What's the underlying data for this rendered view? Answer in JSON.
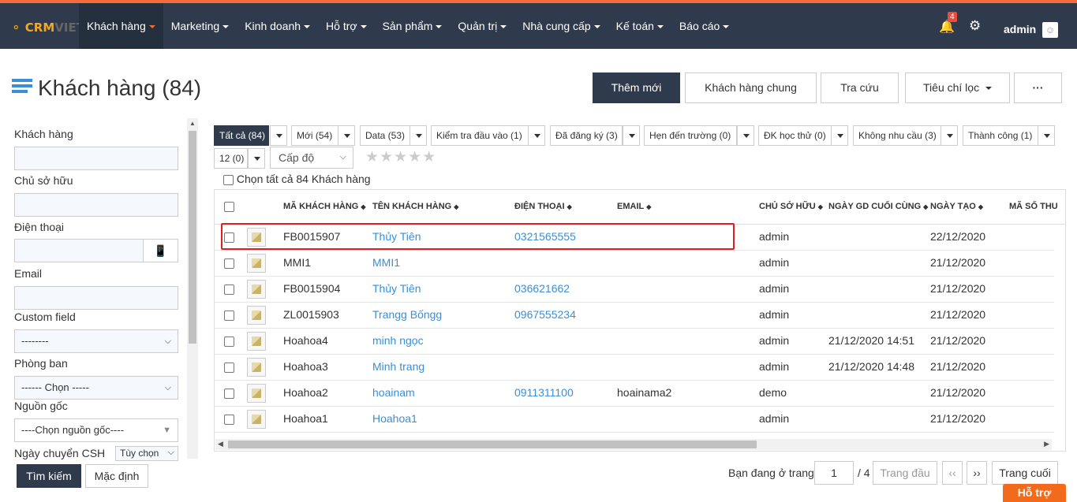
{
  "app": {
    "logo_brand": "CRM",
    "logo_suffix": "VIET"
  },
  "nav": {
    "items": [
      {
        "label": "Khách hàng"
      },
      {
        "label": "Marketing"
      },
      {
        "label": "Kinh doanh"
      },
      {
        "label": "Hỗ trợ"
      },
      {
        "label": "Sản phẩm"
      },
      {
        "label": "Quản trị"
      },
      {
        "label": "Nhà cung cấp"
      },
      {
        "label": "Kế toán"
      },
      {
        "label": "Báo cáo"
      }
    ]
  },
  "header": {
    "notification_count": "4",
    "user_name": "admin",
    "bell_icon": "bell-icon",
    "gear_icon": "gear-icon"
  },
  "page": {
    "title": "Khách hàng (84)"
  },
  "actions": {
    "add_new": "Thêm mới",
    "shared": "Khách hàng chung",
    "lookup": "Tra cứu",
    "criteria": "Tiêu chí lọc",
    "more": "···"
  },
  "sidebar": {
    "customer_label": "Khách hàng",
    "owner_label": "Chủ sở hữu",
    "phone_label": "Điện thoại",
    "email_label": "Email",
    "custom_field_label": "Custom field",
    "custom_field_value": "--------",
    "department_label": "Phòng ban",
    "department_value": "------ Chọn -----",
    "source_label": "Nguồn gốc",
    "source_value": "----Chọn nguồn gốc----",
    "transfer_date_label": "Ngày chuyển CSH",
    "transfer_date_value": "Tùy chọn",
    "search_button": "Tìm kiếm",
    "default_button": "Mặc định"
  },
  "filters": {
    "tabs": [
      {
        "label": "Tất cả (84)"
      },
      {
        "label": "Mới (54)"
      },
      {
        "label": "Data (53)"
      },
      {
        "label": "Kiểm tra đầu vào (1)"
      },
      {
        "label": "Đã đăng ký (3)"
      },
      {
        "label": "Hẹn đến trường (0)"
      },
      {
        "label": "ĐK học thử (0)"
      },
      {
        "label": "Không nhu cầu (3)"
      },
      {
        "label": "Thành công (1)"
      },
      {
        "label": "12 (0)"
      }
    ],
    "level_placeholder": "Cấp độ",
    "stars": "★★★★★",
    "select_all": "Chọn tất cả 84 Khách hàng"
  },
  "table": {
    "columns": [
      "MÃ KHÁCH HÀNG",
      "TÊN KHÁCH HÀNG",
      "ĐIỆN THOẠI",
      "EMAIL",
      "CHỦ SỞ HỮU",
      "NGÀY GD CUỐI CÙNG",
      "NGÀY TẠO",
      "MÃ SỐ THU"
    ],
    "rows": [
      {
        "code": "FB0015907",
        "name": "Thủy Tiên",
        "phone": "0321565555",
        "email": "",
        "owner": "admin",
        "last_trans": "",
        "created": "22/12/2020"
      },
      {
        "code": "MMI1",
        "name": "MMI1",
        "phone": "",
        "email": "",
        "owner": "admin",
        "last_trans": "",
        "created": "21/12/2020"
      },
      {
        "code": "FB0015904",
        "name": "Thủy Tiên",
        "phone": "036621662",
        "email": "",
        "owner": "admin",
        "last_trans": "",
        "created": "21/12/2020"
      },
      {
        "code": "ZL0015903",
        "name": "Trangg Bốngg",
        "phone": "0967555234",
        "email": "",
        "owner": "admin",
        "last_trans": "",
        "created": "21/12/2020"
      },
      {
        "code": "Hoahoa4",
        "name": "minh ngọc",
        "phone": "",
        "email": "",
        "owner": "admin",
        "last_trans": "21/12/2020 14:51",
        "created": "21/12/2020"
      },
      {
        "code": "Hoahoa3",
        "name": "Minh trang",
        "phone": "",
        "email": "",
        "owner": "admin",
        "last_trans": "21/12/2020 14:48",
        "created": "21/12/2020"
      },
      {
        "code": "Hoahoa2",
        "name": "hoainam",
        "phone": "0911311100",
        "email": "hoainama2",
        "owner": "demo",
        "last_trans": "",
        "created": "21/12/2020"
      },
      {
        "code": "Hoahoa1",
        "name": "Hoahoa1",
        "phone": "",
        "email": "",
        "owner": "admin",
        "last_trans": "",
        "created": "21/12/2020"
      }
    ]
  },
  "pager": {
    "label": "Bạn đang ở trang",
    "current": "1",
    "total": "/ 4",
    "first": "Trang đầu",
    "prev": "‹‹",
    "next": "››",
    "last": "Trang cuối"
  },
  "help": {
    "label": "Hỗ trợ"
  }
}
